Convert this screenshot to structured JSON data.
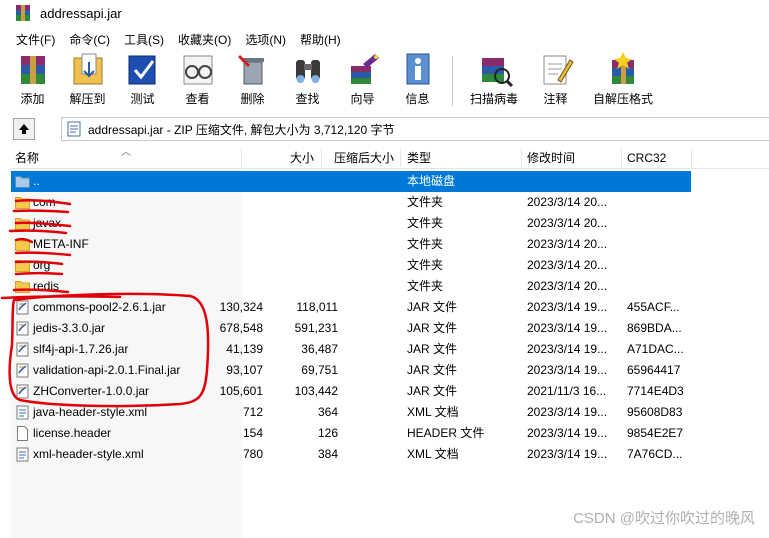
{
  "window": {
    "title": "addressapi.jar"
  },
  "menu": [
    "文件(F)",
    "命令(C)",
    "工具(S)",
    "收藏夹(O)",
    "选项(N)",
    "帮助(H)"
  ],
  "toolbar": {
    "add": "添加",
    "extract": "解压到",
    "test": "测试",
    "view": "查看",
    "delete": "删除",
    "find": "查找",
    "wizard": "向导",
    "info": "信息",
    "scan": "扫描病毒",
    "comment": "注释",
    "sfx": "自解压格式"
  },
  "address": {
    "text": "addressapi.jar - ZIP 压缩文件, 解包大小为 3,712,120 字节"
  },
  "columns": {
    "name": "名称",
    "size": "大小",
    "packed": "压缩后大小",
    "type": "类型",
    "modified": "修改时间",
    "crc": "CRC32"
  },
  "rows": [
    {
      "name": "..",
      "size": "",
      "packed": "",
      "type": "本地磁盘",
      "modified": "",
      "crc": ""
    },
    {
      "name": "com",
      "size": "",
      "packed": "",
      "type": "文件夹",
      "modified": "2023/3/14 20...",
      "crc": ""
    },
    {
      "name": "javax",
      "size": "",
      "packed": "",
      "type": "文件夹",
      "modified": "2023/3/14 20...",
      "crc": ""
    },
    {
      "name": "META-INF",
      "size": "",
      "packed": "",
      "type": "文件夹",
      "modified": "2023/3/14 20...",
      "crc": ""
    },
    {
      "name": "org",
      "size": "",
      "packed": "",
      "type": "文件夹",
      "modified": "2023/3/14 20...",
      "crc": ""
    },
    {
      "name": "redis",
      "size": "",
      "packed": "",
      "type": "文件夹",
      "modified": "2023/3/14 20...",
      "crc": ""
    },
    {
      "name": "commons-pool2-2.6.1.jar",
      "size": "130,324",
      "packed": "118,011",
      "type": "JAR 文件",
      "modified": "2023/3/14 19...",
      "crc": "455ACF..."
    },
    {
      "name": "jedis-3.3.0.jar",
      "size": "678,548",
      "packed": "591,231",
      "type": "JAR 文件",
      "modified": "2023/3/14 19...",
      "crc": "869BDA..."
    },
    {
      "name": "slf4j-api-1.7.26.jar",
      "size": "41,139",
      "packed": "36,487",
      "type": "JAR 文件",
      "modified": "2023/3/14 19...",
      "crc": "A71DAC..."
    },
    {
      "name": "validation-api-2.0.1.Final.jar",
      "size": "93,107",
      "packed": "69,751",
      "type": "JAR 文件",
      "modified": "2023/3/14 19...",
      "crc": "65964417"
    },
    {
      "name": "ZHConverter-1.0.0.jar",
      "size": "105,601",
      "packed": "103,442",
      "type": "JAR 文件",
      "modified": "2021/11/3 16...",
      "crc": "7714E4D3"
    },
    {
      "name": "java-header-style.xml",
      "size": "712",
      "packed": "364",
      "type": "XML 文档",
      "modified": "2023/3/14 19...",
      "crc": "95608D83"
    },
    {
      "name": "license.header",
      "size": "154",
      "packed": "126",
      "type": "HEADER 文件",
      "modified": "2023/3/14 19...",
      "crc": "9854E2E7"
    },
    {
      "name": "xml-header-style.xml",
      "size": "780",
      "packed": "384",
      "type": "XML 文档",
      "modified": "2023/3/14 19...",
      "crc": "7A76CD..."
    }
  ],
  "watermark": "CSDN @吹过你吹过的晚风",
  "colors": {
    "selection": "#0078d7",
    "folder": "#f5c94c",
    "annotation": "#e0000a"
  }
}
